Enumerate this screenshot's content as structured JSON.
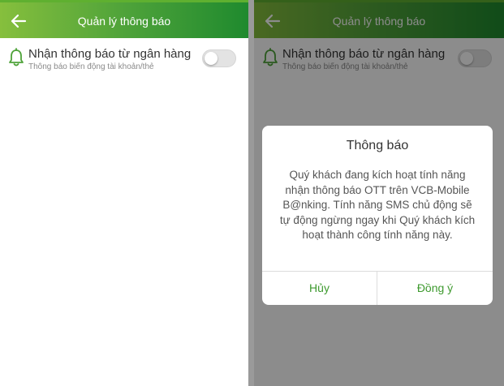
{
  "screen_left": {
    "header": {
      "title": "Quản lý thông báo"
    },
    "setting": {
      "title": "Nhận thông báo từ ngân hàng",
      "subtitle": "Thông báo biến động tài khoản/thẻ",
      "enabled": false
    }
  },
  "screen_right": {
    "header": {
      "title": "Quản lý thông báo"
    },
    "setting": {
      "title": "Nhận thông báo từ ngân hàng",
      "subtitle": "Thông báo biến động tài khoản/thẻ",
      "enabled": false
    },
    "dialog": {
      "title": "Thông báo",
      "message": "Quý khách đang kích hoạt tính năng nhận thông báo OTT trên VCB-Mobile B@nking. Tính năng SMS chủ động sẽ tự động ngừng ngay khi Quý khách kích hoạt thành công tính năng này.",
      "cancel_label": "Hủy",
      "confirm_label": "Đồng ý"
    }
  },
  "icons": {
    "back": "arrow-left-icon",
    "bell": "bell-icon"
  },
  "colors": {
    "header_start": "#86bf3d",
    "header_end": "#1f8a2e",
    "accent": "#3e9a2f"
  }
}
